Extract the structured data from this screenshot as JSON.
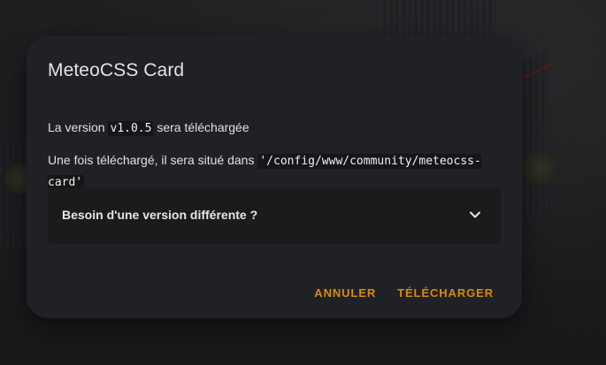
{
  "dialog": {
    "title": "MeteoCSS Card",
    "version_prefix": "La version ",
    "version": "v1.0.5",
    "version_suffix": " sera téléchargée",
    "location_prefix": "Une fois téléchargé, il sera situé dans ",
    "location_path": "'/config/www/community/meteocss-card'",
    "expander_label": "Besoin d'une version différente ?",
    "expander_icon": "chevron-down-icon",
    "cancel_label": "ANNULER",
    "download_label": "TÉLÉCHARGER"
  },
  "colors": {
    "accent": "#d48a12",
    "dialog_bg": "#202124",
    "expander_bg": "#1a1b1d",
    "text": "#e1e1e1"
  }
}
